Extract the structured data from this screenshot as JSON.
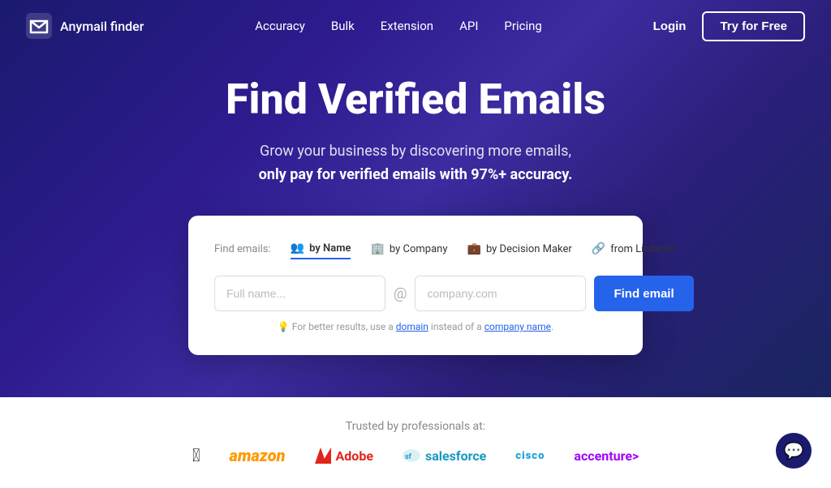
{
  "nav": {
    "logo_text": "Anymail finder",
    "links": [
      "Accuracy",
      "Bulk",
      "Extension",
      "API",
      "Pricing"
    ],
    "login_label": "Login",
    "try_label": "Try for Free"
  },
  "hero": {
    "title": "Find Verified Emails",
    "subtitle_line1": "Grow your business by discovering more emails,",
    "subtitle_line2": "only pay for verified emails with 97%+ accuracy.",
    "search_card": {
      "find_label": "Find emails:",
      "tabs": [
        {
          "id": "by-name",
          "icon": "👥",
          "label": "by Name",
          "active": true
        },
        {
          "id": "by-company",
          "icon": "🏢",
          "label": "by Company",
          "active": false
        },
        {
          "id": "by-decision-maker",
          "icon": "💼",
          "label": "by Decision Maker",
          "active": false
        },
        {
          "id": "from-linkedin",
          "icon": "🔗",
          "label": "from LinkedIn",
          "active": false
        }
      ],
      "name_placeholder": "Full name...",
      "company_placeholder": "company.com",
      "at_symbol": "@",
      "find_button": "Find email",
      "hint_text": "For better results, use a ",
      "hint_link1": "domain",
      "hint_middle": " instead of a ",
      "hint_link2": "company name",
      "hint_end": "."
    }
  },
  "trusted": {
    "label": "Trusted by professionals at:",
    "brands": [
      "🍎",
      "amazon",
      "Adobe",
      "salesforce",
      "cisco",
      "accenture"
    ]
  },
  "chat": {
    "icon": "💬"
  }
}
